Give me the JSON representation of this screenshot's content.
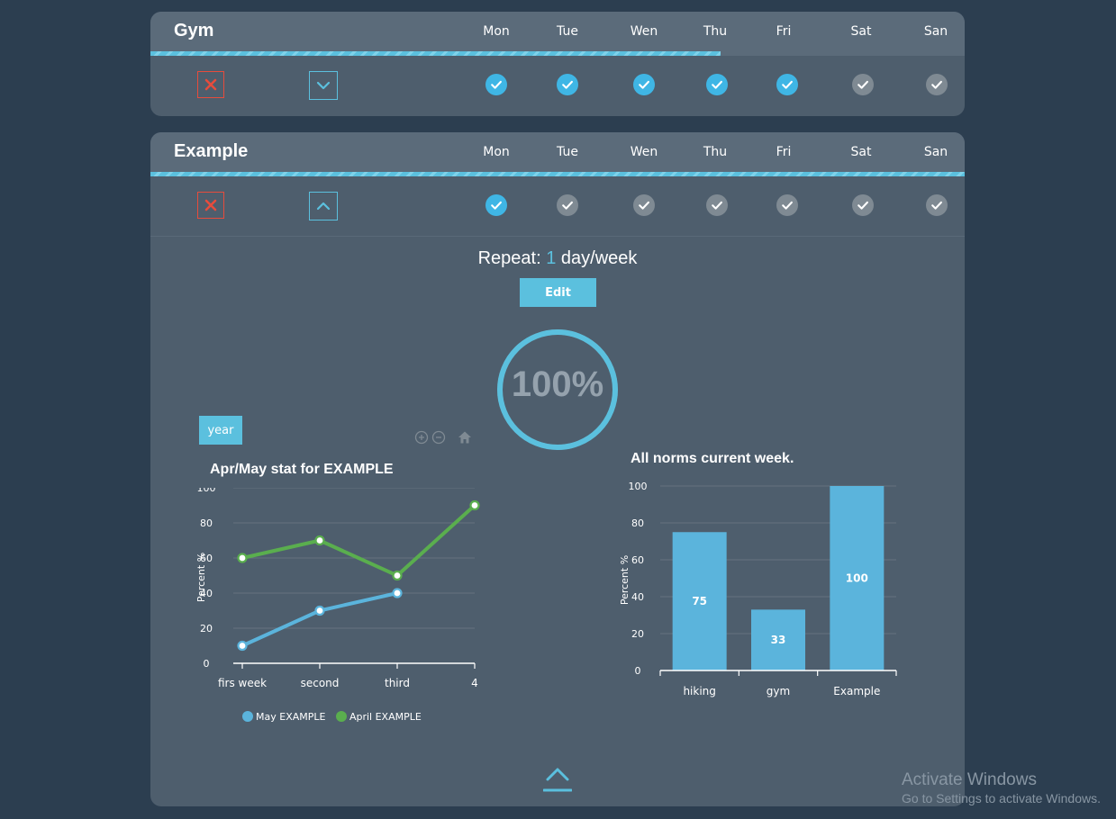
{
  "days": [
    "Mon",
    "Tue",
    "Wen",
    "Thu",
    "Fri",
    "Sat",
    "San"
  ],
  "accent_color": "#5bc0de",
  "done_color": "#3fb6e5",
  "todo_color": "#7f8a93",
  "delete_color": "#e74c3c",
  "icons": {
    "delete": "close-icon",
    "expand": "chevron-down-icon",
    "collapse": "chevron-up-icon",
    "check": "check-circle-icon",
    "zoom_in": "zoom-in-icon",
    "zoom_out": "zoom-out-icon",
    "reset": "home-icon"
  },
  "norms": [
    {
      "title": "Gym",
      "progress_fraction": 0.7,
      "expanded": false,
      "checks": [
        true,
        true,
        true,
        true,
        true,
        false,
        false
      ]
    },
    {
      "title": "Example",
      "progress_fraction": 1.0,
      "expanded": true,
      "checks": [
        true,
        false,
        false,
        false,
        false,
        false,
        false
      ],
      "repeat": {
        "label": "Repeat:",
        "count": "1",
        "unit": "day/week"
      },
      "edit_label": "Edit",
      "completion_percent": 100,
      "completion_text": "100%",
      "year_button": "year"
    }
  ],
  "chart_data": [
    {
      "type": "line",
      "title": "Apr/May stat for EXAMPLE",
      "xlabel": "",
      "ylabel": "Percent %",
      "categories": [
        "firs week",
        "second",
        "third",
        "4"
      ],
      "ylim": [
        0,
        100
      ],
      "yticks": [
        0,
        20,
        40,
        60,
        80,
        100
      ],
      "grid": true,
      "legend_position": "bottom",
      "series": [
        {
          "name": "May EXAMPLE",
          "color": "#5bb4dc",
          "values": [
            10,
            30,
            40,
            null
          ]
        },
        {
          "name": "April EXAMPLE",
          "color": "#5aae4e",
          "values": [
            60,
            70,
            50,
            90
          ]
        }
      ]
    },
    {
      "type": "bar",
      "title": "All norms current week.",
      "xlabel": "",
      "ylabel": "Percent %",
      "categories": [
        "hiking",
        "gym",
        "Example"
      ],
      "values": [
        75,
        33,
        100
      ],
      "data_labels": [
        "75",
        "33",
        "100"
      ],
      "ylim": [
        0,
        100
      ],
      "yticks": [
        0,
        20,
        40,
        60,
        80,
        100
      ],
      "grid": true,
      "color": "#5bb4dc"
    }
  ],
  "watermark": {
    "title": "Activate Windows",
    "subtitle": "Go to Settings to activate Windows."
  }
}
